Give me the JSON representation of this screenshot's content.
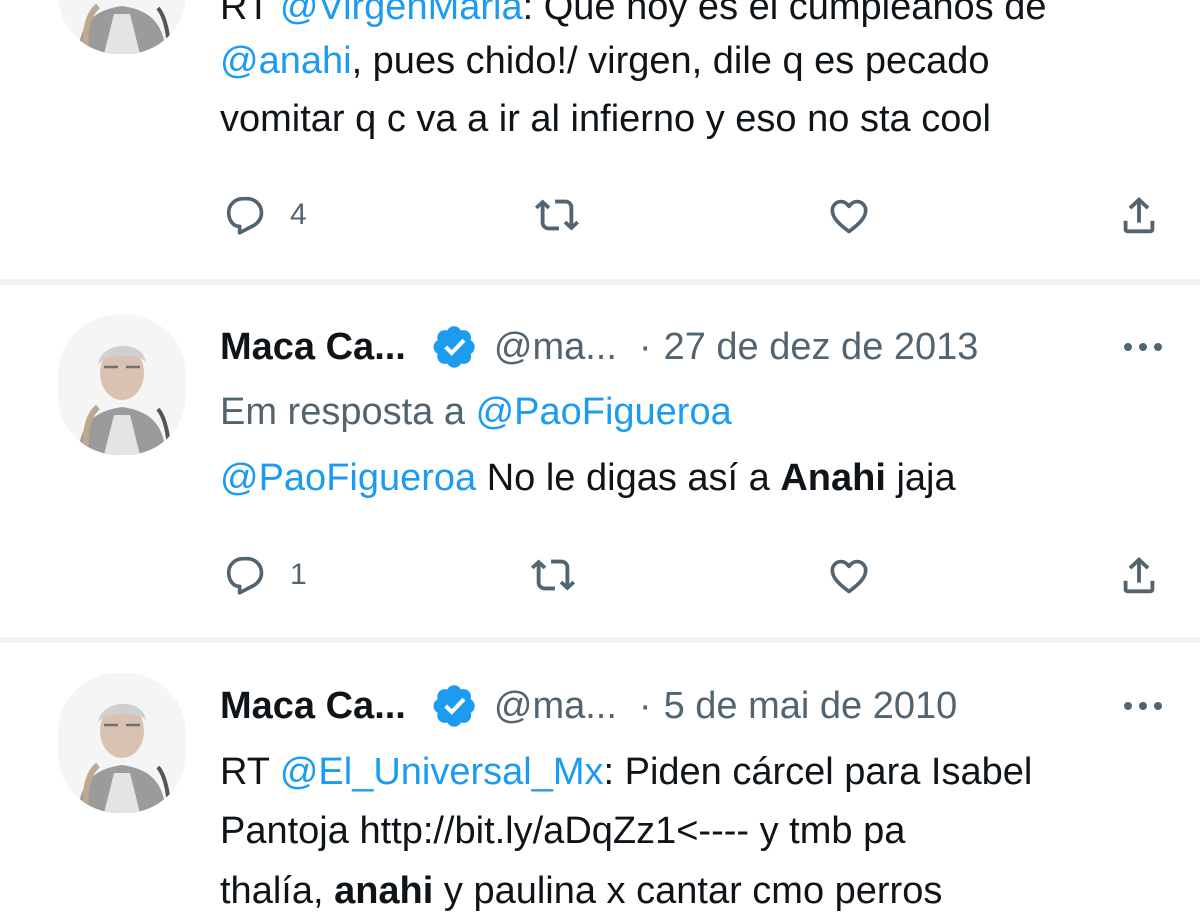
{
  "tweets": [
    {
      "lines": {
        "l0a": "RT ",
        "l0b": "@VirgenMaria",
        "l0c": ": Que hoy es el cumpleaños de",
        "l1a": "@anahi",
        "l1b": ", pues chido!/ virgen, dile q es pecado",
        "l2": "vomitar q c va a ir al infierno y eso no sta cool"
      },
      "reply_count": "4"
    },
    {
      "name": "Maca Ca...",
      "handle": "@ma...",
      "dot": "·",
      "date": "27 de dez de 2013",
      "in_reply_label": "Em resposta a ",
      "in_reply_to": "@PaoFigueroa",
      "body": {
        "mention": "@PaoFigueroa",
        "text1": " No le digas así a ",
        "bold": "Anahi",
        "text2": " jaja"
      },
      "reply_count": "1"
    },
    {
      "name": "Maca Ca...",
      "handle": "@ma...",
      "dot": "·",
      "date": "5 de mai de 2010",
      "lines": {
        "l0a": "RT ",
        "l0b": "@El_Universal_Mx",
        "l0c": ": Piden cárcel para Isabel",
        "l1": "Pantoja  http://bit.ly/aDqZz1<---- y tmb pa",
        "l2a": "thalía, ",
        "l2b": "anahi",
        "l2c": " y paulina x cantar cmo perros"
      }
    }
  ],
  "colors": {
    "link": "#1d9bf0",
    "text": "#0f1419",
    "muted": "#536471",
    "verified": "#1d9bf0",
    "divider": "#eff3f4"
  },
  "icons": [
    "reply-icon",
    "retweet-icon",
    "like-icon",
    "share-icon",
    "verified-badge-icon",
    "more-icon"
  ]
}
